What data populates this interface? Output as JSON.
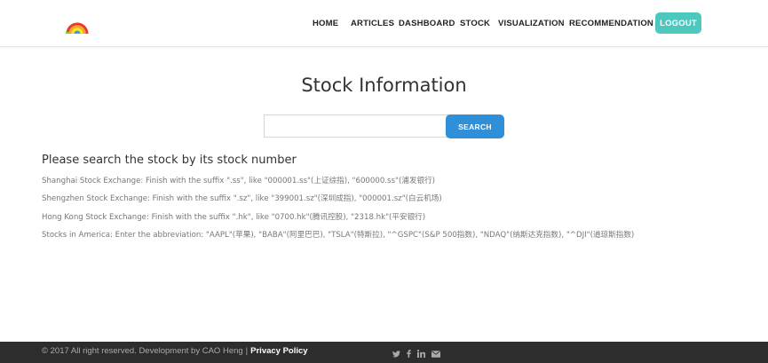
{
  "header": {
    "logo_icon": "rainbow-icon",
    "nav": {
      "home": "HOME",
      "articles": "ARTICLES",
      "dashboard": "DASHBOARD",
      "stock": "STOCK",
      "visualization": "VISUALIZATION",
      "recommendation": "RECOMMENDATION"
    },
    "logout_label": "LOGOUT",
    "logout_color": "#4dc8be"
  },
  "main": {
    "title": "Stock Information",
    "search": {
      "value": "",
      "placeholder": "",
      "button_label": "SEARCH",
      "button_color": "#2f8fd8"
    },
    "subheading": "Please search the stock by its stock number",
    "lines": [
      "Shanghai Stock Exchange: Finish with the suffix \".ss\", like \"000001.ss\"(上证综指), \"600000.ss\"(浦发银行)",
      "Shengzhen Stock Exchange: Finish with the suffix \".sz\", like \"399001.sz\"(深圳成指), \"000001.sz\"(白云机场)",
      "Hong Kong Stock Exchange: Finish with the suffix \".hk\", like \"0700.hk\"(腾讯控股), \"2318.hk\"(平安银行)",
      "Stocks in America: Enter the abbreviation: \"AAPL\"(苹果), \"BABA\"(阿里巴巴), \"TSLA\"(特斯拉), \"^GSPC\"(S&P 500指数), \"NDAQ\"(纳斯达克指数), \"^DJI\"(道琼斯指数)"
    ]
  },
  "footer": {
    "copyright": "© 2017 All right reserved. Development by CAO Heng",
    "separator": "|",
    "privacy_label": "Privacy Policy",
    "social_icons": [
      "twitter-icon",
      "facebook-icon",
      "linkedin-icon",
      "email-icon"
    ],
    "background": "#2d2d2d"
  }
}
